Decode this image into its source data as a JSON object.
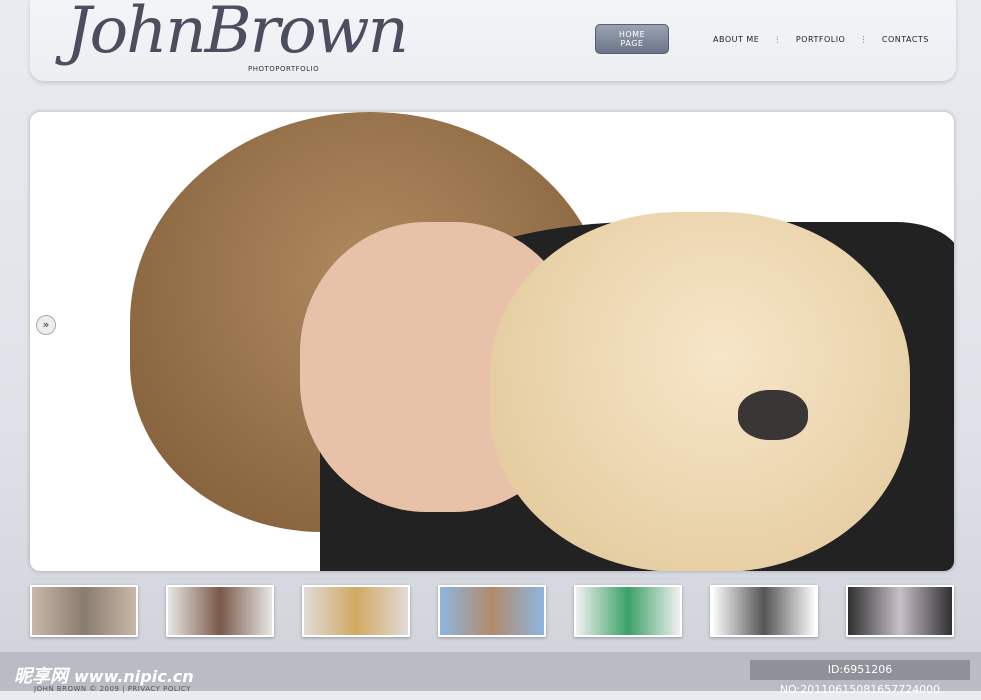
{
  "header": {
    "logo": "JohnBrown",
    "logo_sub": "PHOTOPORTFOLIO"
  },
  "nav": {
    "items": [
      "HOME PAGE",
      "ABOUT ME",
      "PORTFOLIO",
      "CONTACTS"
    ],
    "separator": "⋮"
  },
  "slider": {
    "next_icon": "»"
  },
  "thumbnails": [
    {
      "colors": [
        "#c9b8a8",
        "#8a7b70"
      ]
    },
    {
      "colors": [
        "#e8e6e6",
        "#7a5a4a"
      ]
    },
    {
      "colors": [
        "#e0dcd8",
        "#d2a860"
      ]
    },
    {
      "colors": [
        "#8fb6e0",
        "#b08a6a"
      ]
    },
    {
      "colors": [
        "#f0f0f0",
        "#3aa066"
      ]
    },
    {
      "colors": [
        "#ffffff",
        "#555555"
      ]
    },
    {
      "colors": [
        "#303030",
        "#c8c0c8"
      ]
    }
  ],
  "footer": {
    "watermark": "昵享网",
    "watermark_url": "www.nipic.cn",
    "copyright": "JOHN BROWN © 2009 | PRIVACY POLICY",
    "id_text": "ID:6951206 NO:20110615081657724000"
  }
}
